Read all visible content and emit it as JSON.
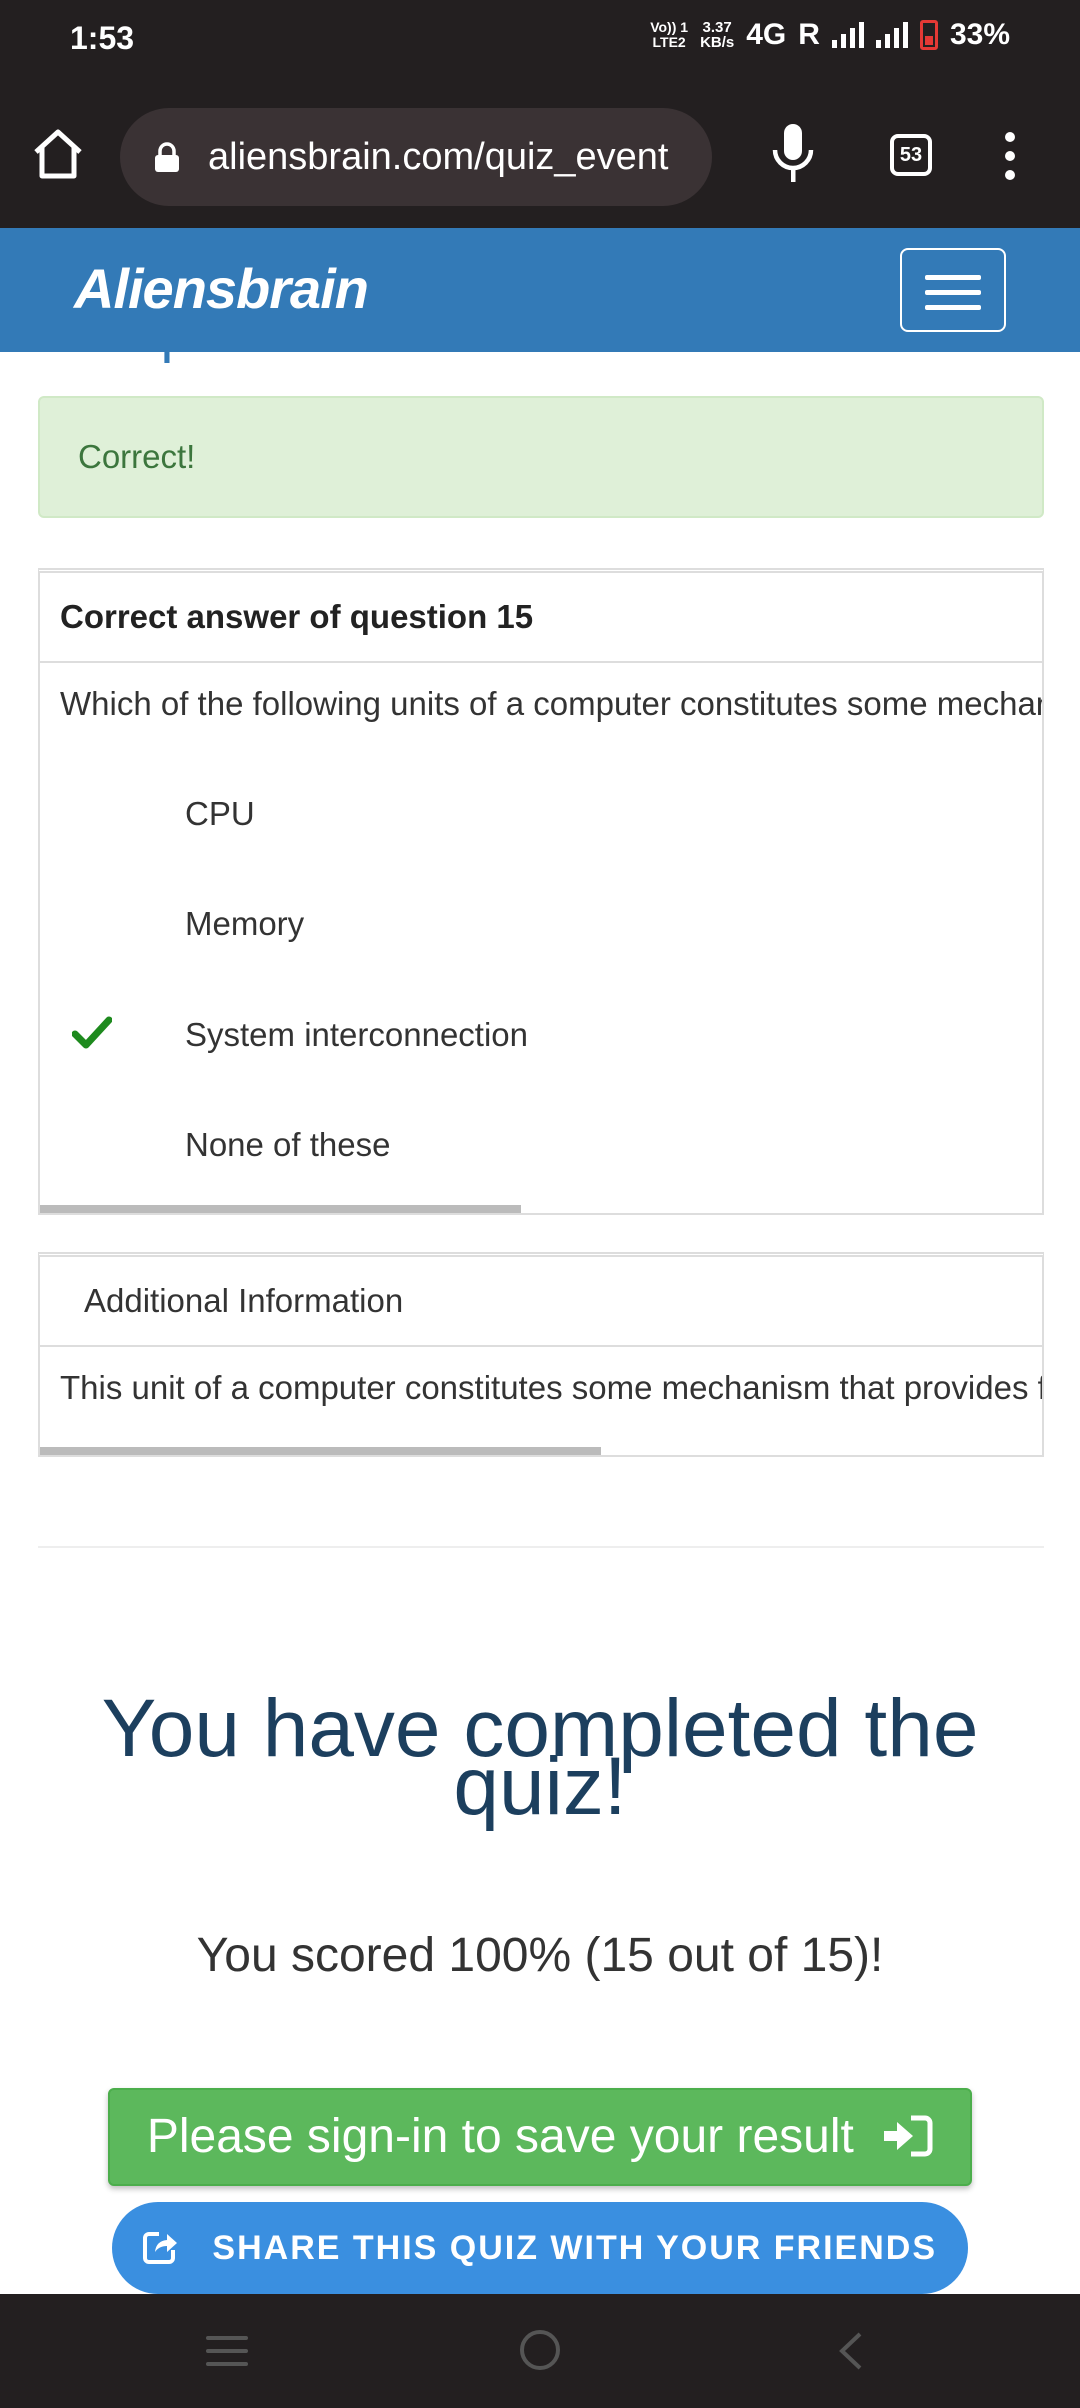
{
  "status_bar": {
    "time": "1:53",
    "volte_top": "Vo)) 1",
    "volte_bottom": "LTE2",
    "speed_value": "3.37",
    "speed_unit": "KB/s",
    "network": "4G",
    "roaming": "R",
    "battery": "33%"
  },
  "browser": {
    "url": "aliensbrain.com/quiz_event",
    "tab_count": "53"
  },
  "site": {
    "brand": "Aliensbrain",
    "page_heading": "Computer Architecture"
  },
  "alert": {
    "text": "Correct!"
  },
  "question_panel": {
    "heading": "Correct answer of question 15",
    "question": "Which of the following units of a computer constitutes some mechanism that provides for communication among CPU, main memory and I/O?",
    "options": [
      {
        "label": "CPU",
        "correct": false
      },
      {
        "label": "Memory",
        "correct": false
      },
      {
        "label": "System interconnection",
        "correct": true
      },
      {
        "label": "None of these",
        "correct": false
      }
    ],
    "scroll_fraction": 0.48
  },
  "info_panel": {
    "heading": "Additional Information",
    "text": "This unit of a computer constitutes some mechanism that provides for communication among CPU, main memory and I/O.",
    "scroll_fraction": 0.56
  },
  "result": {
    "completed_line1": "You have completed the",
    "completed_line2": "quiz!",
    "score": "You scored 100% (15 out of 15)!"
  },
  "buttons": {
    "signin": "Please sign-in to save your result",
    "share": "SHARE THIS QUIZ WITH YOUR FRIENDS"
  },
  "colors": {
    "brand_blue": "#337ab7",
    "success_green": "#5cb85c",
    "share_blue": "#3a8fe0",
    "check_green": "#1e8a1e"
  }
}
